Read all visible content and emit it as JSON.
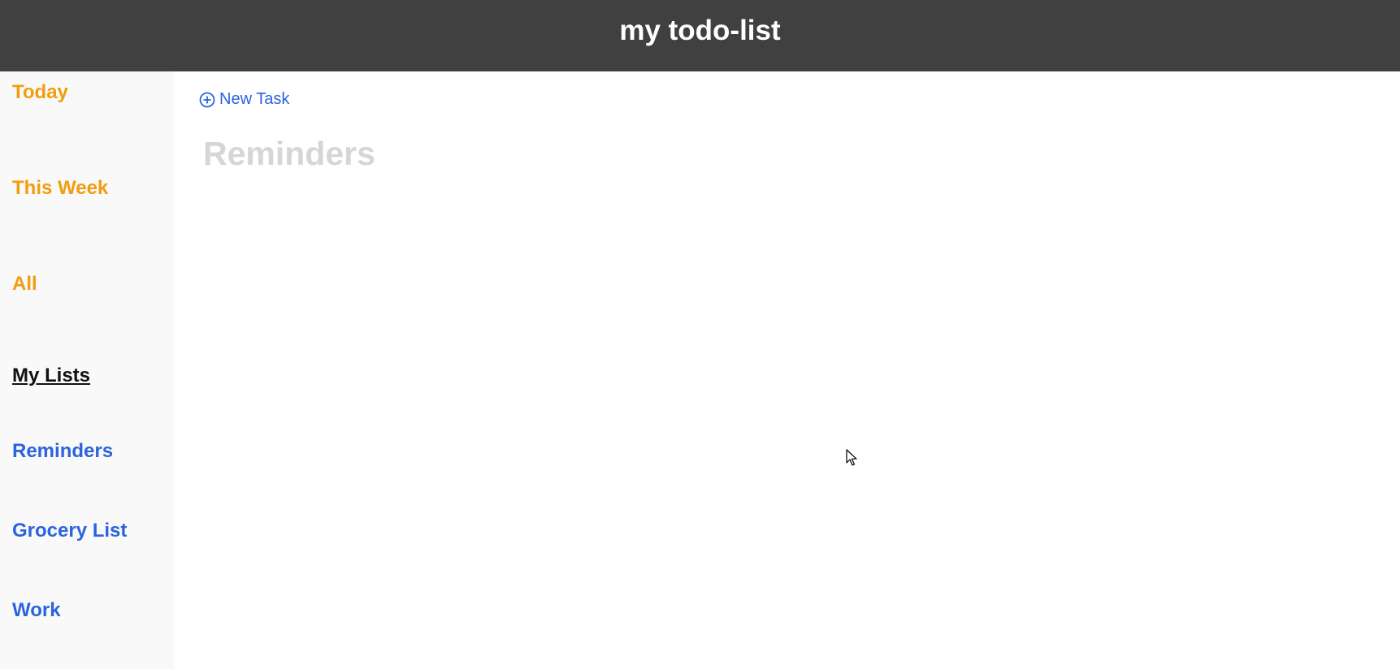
{
  "header": {
    "title": "my todo-list"
  },
  "sidebar": {
    "filters": [
      {
        "label": "Today"
      },
      {
        "label": "This Week"
      },
      {
        "label": "All"
      }
    ],
    "lists_heading": "My Lists",
    "lists": [
      {
        "label": "Reminders"
      },
      {
        "label": "Grocery List"
      },
      {
        "label": "Work"
      }
    ]
  },
  "main": {
    "new_task_label": "New Task",
    "new_task_icon": "plus-circle-icon",
    "list_title": "Reminders"
  },
  "colors": {
    "header_bg": "#404040",
    "sidebar_bg": "#f9f9f9",
    "filter_accent": "#f29d0e",
    "list_accent": "#2b64dd",
    "title_muted": "#d6d6d6"
  }
}
